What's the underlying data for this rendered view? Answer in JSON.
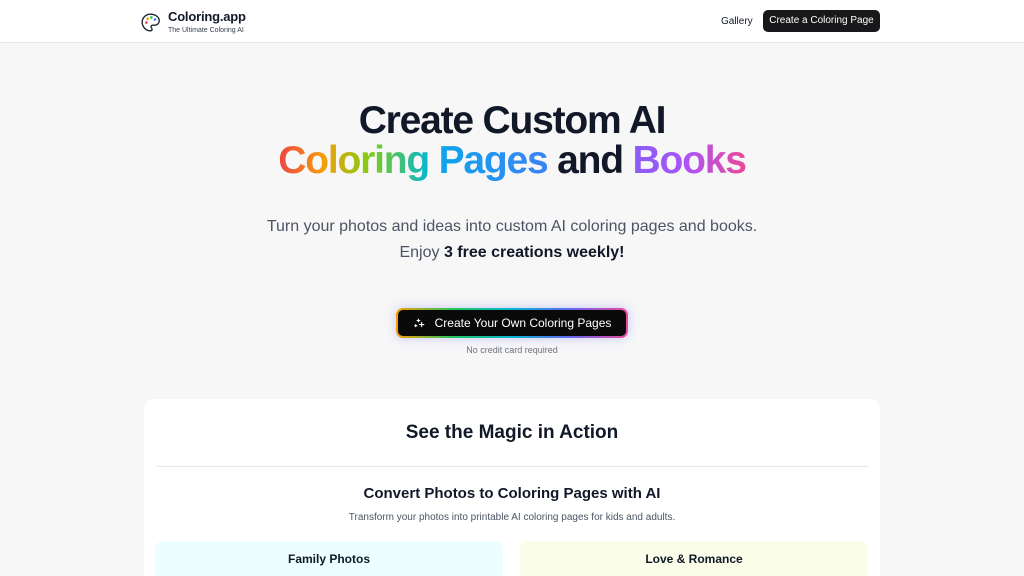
{
  "header": {
    "brand_name": "Coloring.app",
    "brand_tagline": "The Ultimate Coloring AI",
    "nav_gallery": "Gallery",
    "nav_cta": "Create a Coloring Page"
  },
  "hero": {
    "title_line1": "Create Custom AI",
    "title_word1": "Coloring",
    "title_word2": "Pages",
    "title_word3": "and",
    "title_word4": "Books",
    "subtitle": "Turn your photos and ideas into custom AI coloring pages and books.",
    "subtitle2_prefix": "Enjoy ",
    "subtitle2_bold": "3 free creations weekly!",
    "cta_label": "Create Your Own Coloring Pages",
    "cta_note": "No credit card required"
  },
  "magic": {
    "title": "See the Magic in Action",
    "section_title": "Convert Photos to Coloring Pages with AI",
    "section_subtitle": "Transform your photos into printable AI coloring pages for kids and adults.",
    "cards": [
      {
        "label": "Family Photos"
      },
      {
        "label": "Love & Romance"
      }
    ]
  },
  "colors": {
    "cta_bg": "#18181b",
    "page_bg": "#f7f7f8",
    "card_family_bg": "#ecfeff",
    "card_love_bg": "#fafde8"
  },
  "icons": {
    "brand": "palette-icon",
    "cta": "sparkles-icon"
  }
}
